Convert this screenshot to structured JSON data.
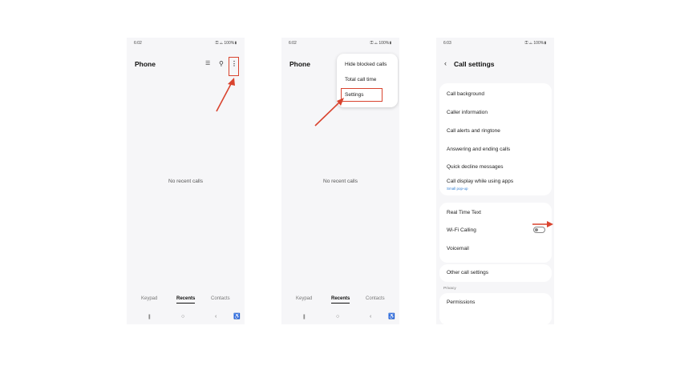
{
  "colors": {
    "annotation": "#d9442f",
    "accent_link": "#2e7dd1",
    "screen_bg": "#f6f6f8"
  },
  "screens": [
    {
      "status": {
        "time": "6:02",
        "left_icons": "◘ ◍ ◉ •",
        "right": "⚿ ◬ 100%▮"
      },
      "title": "Phone",
      "icons": {
        "filter": "filter-icon",
        "search": "search-icon",
        "more": "more-options-icon"
      },
      "empty_text": "No recent calls",
      "tabs": [
        "Keypad",
        "Recents",
        "Contacts"
      ]
    },
    {
      "status": {
        "time": "6:02",
        "left_icons": "◘ ◍ ◉ •",
        "right": "⚿ ◬ 100%▮"
      },
      "title": "Phone",
      "menu": [
        "Hide blocked calls",
        "Total call time",
        "Settings"
      ],
      "empty_text": "No recent calls",
      "tabs": [
        "Keypad",
        "Recents",
        "Contacts"
      ]
    },
    {
      "status": {
        "time": "6:03",
        "left_icons": "◘ ◍ ◉ •",
        "right": "⚿ ◬ 100%▮"
      },
      "title": "Call settings",
      "group1": [
        "Call background",
        "Caller information",
        "Call alerts and ringtone",
        "Answering and ending calls",
        "Quick decline messages",
        "Call display while using apps"
      ],
      "group1_sub": "Small pop-up",
      "group2": [
        "Real Time Text",
        "Wi-Fi Calling",
        "Voicemail"
      ],
      "wifi_calling_on": false,
      "group3": [
        "Other call settings"
      ],
      "section_privacy": "Privacy",
      "group4": [
        "Permissions"
      ]
    }
  ],
  "navbar": {
    "recent_apps": "|||",
    "home": "○",
    "back": "‹",
    "accessibility": "♿"
  },
  "glyphs": {
    "filter": "☰",
    "search": "⚲",
    "more": "⋮",
    "back": "‹"
  }
}
